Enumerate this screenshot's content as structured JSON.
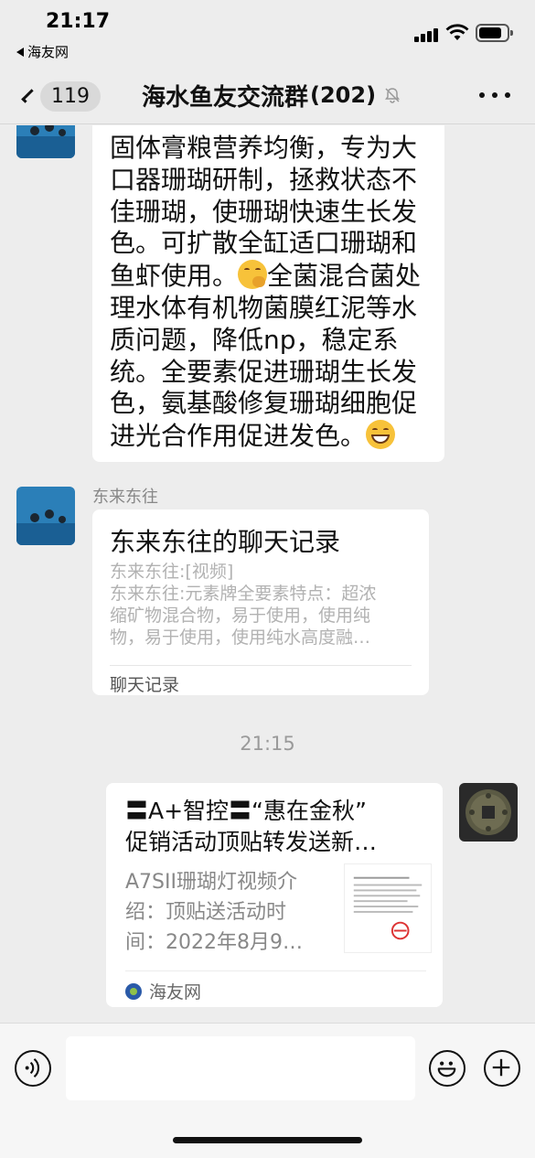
{
  "status_bar": {
    "time": "21:17",
    "back_app": "海友网"
  },
  "nav": {
    "back_count": "119",
    "title": "海水鱼友交流群",
    "member_count": "(202)",
    "icons": {
      "back": "chevron-left-icon",
      "mute": "bell-mute-icon",
      "more": "more-dots-icon"
    }
  },
  "messages": [
    {
      "type": "text",
      "lines": [
        "固体膏粮营养均衡，专为大",
        "口器珊瑚研制，拯救状态不",
        "佳珊瑚，使珊瑚快速生长发",
        "色。可扩散全缸适口珊瑚和",
        "鱼虾使用。",
        "全菌混合菌处",
        "理水体有机物菌膜红泥等水",
        "质问题，降低np，稳定系",
        "统。全要素促进珊瑚生长发",
        "色，氨基酸修复珊瑚细胞促",
        "进光合作用促进发色。"
      ],
      "emojis": [
        "thinking-face-emoji",
        "grinning-face-emoji"
      ]
    },
    {
      "type": "chat_record",
      "sender": "东来东往",
      "title": "东来东往的聊天记录",
      "preview_lines": [
        "东来东往:[视频]",
        "东来东往:元素牌全要素特点：超浓",
        "缩矿物混合物，易于使用，使用纯",
        "物，易于使用，使用纯水高度融…"
      ],
      "footer": "聊天记录"
    },
    {
      "type": "timestamp",
      "text": "21:15"
    },
    {
      "type": "link",
      "title_lines": [
        "〓A+智控〓“惠在金秋”",
        "促销活动顶贴转发送新…"
      ],
      "desc_lines": [
        "A7SII珊瑚灯视频介",
        "绍：顶贴送活动时",
        "间：2022年8月9…"
      ],
      "source": "海友网"
    }
  ],
  "input_bar": {
    "placeholder": "",
    "icons": {
      "voice": "voice-icon",
      "emoji": "emoji-icon",
      "plus": "plus-icon"
    }
  }
}
